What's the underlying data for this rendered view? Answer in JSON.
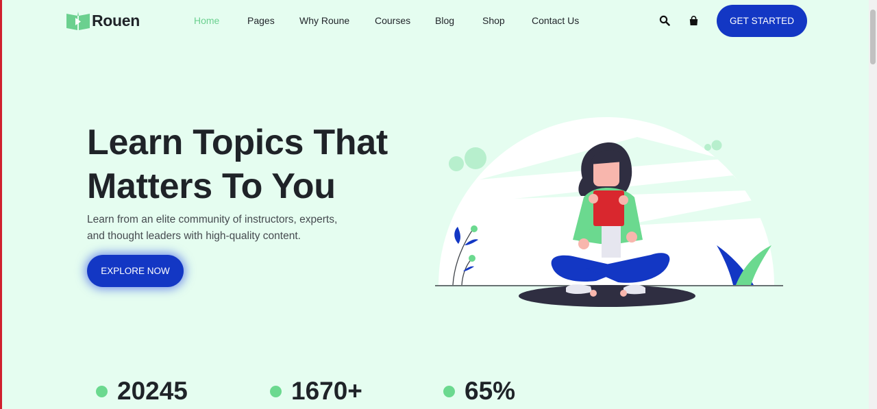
{
  "brand": {
    "name": "Rouen",
    "logo_icon": "book-play-icon"
  },
  "nav": {
    "items": [
      {
        "label": "Home",
        "active": true
      },
      {
        "label": "Pages",
        "active": false
      },
      {
        "label": "Why Roune",
        "active": false
      },
      {
        "label": "Courses",
        "active": false
      },
      {
        "label": "Blog",
        "active": false
      },
      {
        "label": "Shop",
        "active": false
      },
      {
        "label": "Contact Us",
        "active": false
      }
    ]
  },
  "header_icons": {
    "search": "search-icon",
    "cart": "shopping-bag-icon"
  },
  "header_cta": {
    "label": "GET STARTED"
  },
  "hero": {
    "title_line1": "Learn Topics That",
    "title_line2": "Matters To You",
    "subtitle_line1": "Learn from an elite community of instructors, experts,",
    "subtitle_line2": "and thought leaders with high-quality content.",
    "button_label": "EXPLORE NOW",
    "illustration": "woman-reading-book-illustration"
  },
  "stats": [
    {
      "value": "20245"
    },
    {
      "value": "1670+"
    },
    {
      "value": "65%"
    }
  ],
  "colors": {
    "background": "#e5fdf0",
    "primary": "#1337c4",
    "accent_green": "#6bd08f",
    "text_dark": "#1f2328"
  }
}
